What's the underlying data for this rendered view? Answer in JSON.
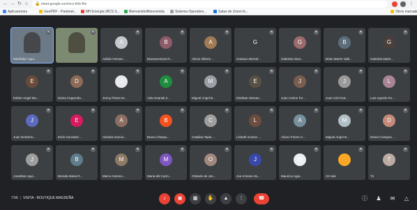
{
  "browser": {
    "url": "meet.google.com/xcx-tfxb-fhx",
    "bookmarks": [
      {
        "label": "Aplicaciones",
        "color": "#4285f4"
      },
      {
        "label": "GeoPDF - Parámet...",
        "color": "#fbbc04"
      },
      {
        "label": "MH Energía (BCS S...",
        "color": "#ea4335"
      },
      {
        "label": "Bienvenido/Bienvenida",
        "color": "#34a853"
      },
      {
        "label": "Sistema Operativo...",
        "color": "#9aa0a6"
      },
      {
        "label": "Salas de Zoom fo...",
        "color": "#1a73e8"
      },
      {
        "label": "Otros marcadores",
        "color": "#fbbc04"
      }
    ]
  },
  "meeting": {
    "time": "7:56",
    "title": "VISITA - BOUTIQUE MAGDEÑA"
  },
  "participants": [
    {
      "name": "Marthalyn Agui...",
      "type": "video",
      "color": "#6b7a86",
      "selected": true
    },
    {
      "name": "",
      "type": "video",
      "color": "#7d8a72"
    },
    {
      "name": "Adrián Hernan...",
      "initial": "A",
      "color": "#c5c8cc"
    },
    {
      "name": "Buenaventura R...",
      "initial": "B",
      "color": "#8e5b6a"
    },
    {
      "name": "Alexis Alberto ...",
      "initial": "A",
      "color": "#a07a55"
    },
    {
      "name": "Gustavo Bernal...",
      "initial": "G",
      "color": "#3b3f44"
    },
    {
      "name": "Gabriela Alvar...",
      "initial": "G",
      "color": "#9b6b6b"
    },
    {
      "name": "Brian Martin Valb...",
      "initial": "B",
      "color": "#5c6e7a"
    },
    {
      "name": "Gabriela Marin...",
      "initial": "G",
      "color": "#4a3f3a"
    },
    {
      "name": "Esther Angel Mo...",
      "initial": "E",
      "color": "#6a4b3a"
    },
    {
      "name": "Dania Cegarrala...",
      "initial": "D",
      "color": "#8c6a55"
    },
    {
      "name": "Jenny Flores M...",
      "initial": "J",
      "color": "#e8eaed"
    },
    {
      "name": "Ada Amanali Z...",
      "initial": "A",
      "color": "#1e8e3e"
    },
    {
      "name": "Miguel Angel B...",
      "initial": "M",
      "color": "#9aa0a6"
    },
    {
      "name": "Esteban Hernan...",
      "initial": "E",
      "color": "#5a5045"
    },
    {
      "name": "Juan Carlos Tor...",
      "initial": "J",
      "color": "#7a5f50"
    },
    {
      "name": "Juan Ariel Gut...",
      "initial": "J",
      "color": "#9a9a9a"
    },
    {
      "name": "Luis Agustin Ro...",
      "initial": "L",
      "color": "#a88495"
    },
    {
      "name": "Juan Norberto...",
      "initial": "J",
      "color": "#5c6bc0"
    },
    {
      "name": "Erick Gonzalez...",
      "initial": "E",
      "color": "#d81b60"
    },
    {
      "name": "Alondra Garcia...",
      "initial": "A",
      "color": "#8d6e63"
    },
    {
      "name": "Bruno Charqu...",
      "initial": "B",
      "color": "#f4511e"
    },
    {
      "name": "Catalina Tapia ...",
      "initial": "C",
      "color": "#9e9e9e"
    },
    {
      "name": "Lizbeth Gomez ...",
      "initial": "L",
      "color": "#6d4c41"
    },
    {
      "name": "Alvaro Flores C...",
      "initial": "A",
      "color": "#78909c"
    },
    {
      "name": "Miguel Angel B...",
      "initial": "M",
      "color": "#b0bec5"
    },
    {
      "name": "Daniel Campos ...",
      "initial": "D",
      "color": "#c48b7a"
    },
    {
      "name": "Jonathan Agui...",
      "initial": "J",
      "color": "#9e9e9e"
    },
    {
      "name": "Brenda Maria R...",
      "initial": "B",
      "color": "#607d8b"
    },
    {
      "name": "Marco Antonio...",
      "initial": "M",
      "color": "#8d7a65"
    },
    {
      "name": "Maria del Carm...",
      "initial": "M",
      "color": "#7e57c2"
    },
    {
      "name": "Orlando de Jes...",
      "initial": "O",
      "color": "#a1887f"
    },
    {
      "name": "Joe Antonio Va...",
      "initial": "J",
      "color": "#3949ab"
    },
    {
      "name": "Mauricio Agui...",
      "initial": "M",
      "color": "#eceff1"
    },
    {
      "name": "22 más",
      "initial": "",
      "color": "#f9a825"
    },
    {
      "name": "Tú",
      "initial": "T",
      "color": "#bcaaa4"
    }
  ]
}
